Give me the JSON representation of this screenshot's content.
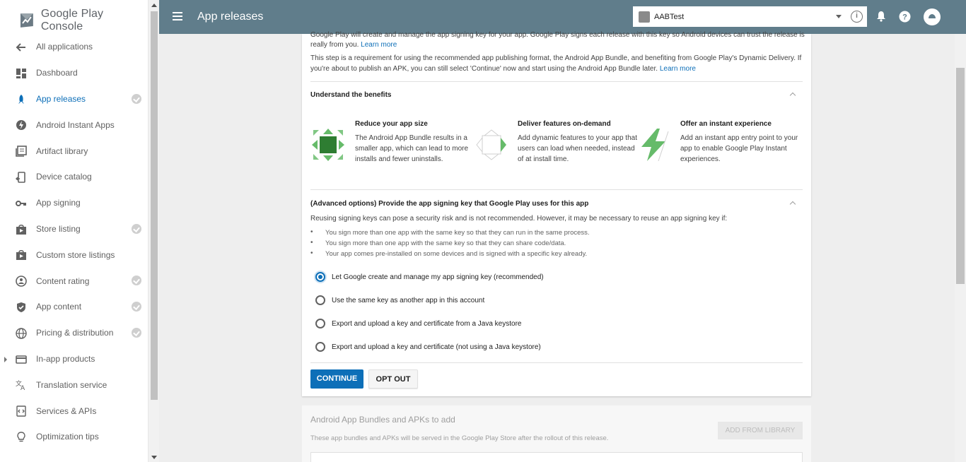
{
  "brand": {
    "name": "Google Play Console"
  },
  "sidebar": {
    "items": [
      {
        "label": "All applications",
        "icon": "arrow-back-icon",
        "active": false,
        "checked": false
      },
      {
        "label": "Dashboard",
        "icon": "dashboard-icon",
        "active": false,
        "checked": false
      },
      {
        "label": "App releases",
        "icon": "rocket-icon",
        "active": true,
        "checked": true
      },
      {
        "label": "Android Instant Apps",
        "icon": "bolt-icon",
        "active": false,
        "checked": false
      },
      {
        "label": "Artifact library",
        "icon": "library-icon",
        "active": false,
        "checked": false
      },
      {
        "label": "Device catalog",
        "icon": "devices-icon",
        "active": false,
        "checked": false
      },
      {
        "label": "App signing",
        "icon": "key-icon",
        "active": false,
        "checked": false
      },
      {
        "label": "Store listing",
        "icon": "store-icon",
        "active": false,
        "checked": true
      },
      {
        "label": "Custom store listings",
        "icon": "store-icon",
        "active": false,
        "checked": false
      },
      {
        "label": "Content rating",
        "icon": "rating-icon",
        "active": false,
        "checked": true
      },
      {
        "label": "App content",
        "icon": "shield-icon",
        "active": false,
        "checked": true
      },
      {
        "label": "Pricing & distribution",
        "icon": "globe-icon",
        "active": false,
        "checked": true
      },
      {
        "label": "In-app products",
        "icon": "card-icon",
        "active": false,
        "checked": false
      },
      {
        "label": "Translation service",
        "icon": "translate-icon",
        "active": false,
        "checked": false
      },
      {
        "label": "Services & APIs",
        "icon": "api-icon",
        "active": false,
        "checked": false
      },
      {
        "label": "Optimization tips",
        "icon": "lightbulb-icon",
        "active": false,
        "checked": false
      }
    ]
  },
  "header": {
    "title": "App releases",
    "app_name": "AABTest"
  },
  "card": {
    "intro1": "Google Play will create and manage the app signing key for your app. Google Play signs each release with this key so Android devices can trust the release is",
    "intro1b": "really from you.",
    "learn_more": "Learn more",
    "intro2a": "This step is a requirement for using the recommended app publishing format, the Android App Bundle, and benefiting from Google Play's Dynamic Delivery. If",
    "intro2b": "you're about to publish an APK, you can still select 'Continue' now and start using the Android App Bundle later.",
    "benefits_title": "Understand the benefits",
    "benefits": [
      {
        "title": "Reduce your app size",
        "desc": [
          "The Android App Bundle results in a",
          "smaller app, which can lead to more",
          "installs and fewer uninstalls."
        ]
      },
      {
        "title": "Deliver features on-demand",
        "desc": [
          "Add dynamic features to your app that",
          "users can load when needed, instead",
          "of at install time."
        ]
      },
      {
        "title": "Offer an instant experience",
        "desc": [
          "Add an instant app entry point to your",
          "app to enable Google Play Instant",
          "experiences."
        ]
      }
    ],
    "advanced_title": "(Advanced options) Provide the app signing key that Google Play uses for this app",
    "advanced_desc": "Reusing signing keys can pose a security risk and is not recommended. However, it may be necessary to reuse an app signing key if:",
    "bullets": [
      "You sign more than one app with the same key so that they can run in the same process.",
      "You sign more than one app with the same key so that they can share code/data.",
      "Your app comes pre-installed on some devices and is signed with a specific key already."
    ],
    "options": [
      {
        "label": "Let Google create and manage my app signing key (recommended)",
        "selected": true
      },
      {
        "label": "Use the same key as another app in this account",
        "selected": false
      },
      {
        "label": "Export and upload a key and certificate from a Java keystore",
        "selected": false
      },
      {
        "label": "Export and upload a key and certificate (not using a Java keystore)",
        "selected": false
      }
    ],
    "continue_label": "CONTINUE",
    "optout_label": "OPT OUT"
  },
  "bundles": {
    "title": "Android App Bundles and APKs to add",
    "desc": "These app bundles and APKs will be served in the Google Play Store after the rollout of this release.",
    "add_label": "ADD FROM LIBRARY"
  },
  "colors": {
    "header": "#607d8b",
    "accent": "#0d6fb8",
    "benefit_green": "#4caf50"
  }
}
